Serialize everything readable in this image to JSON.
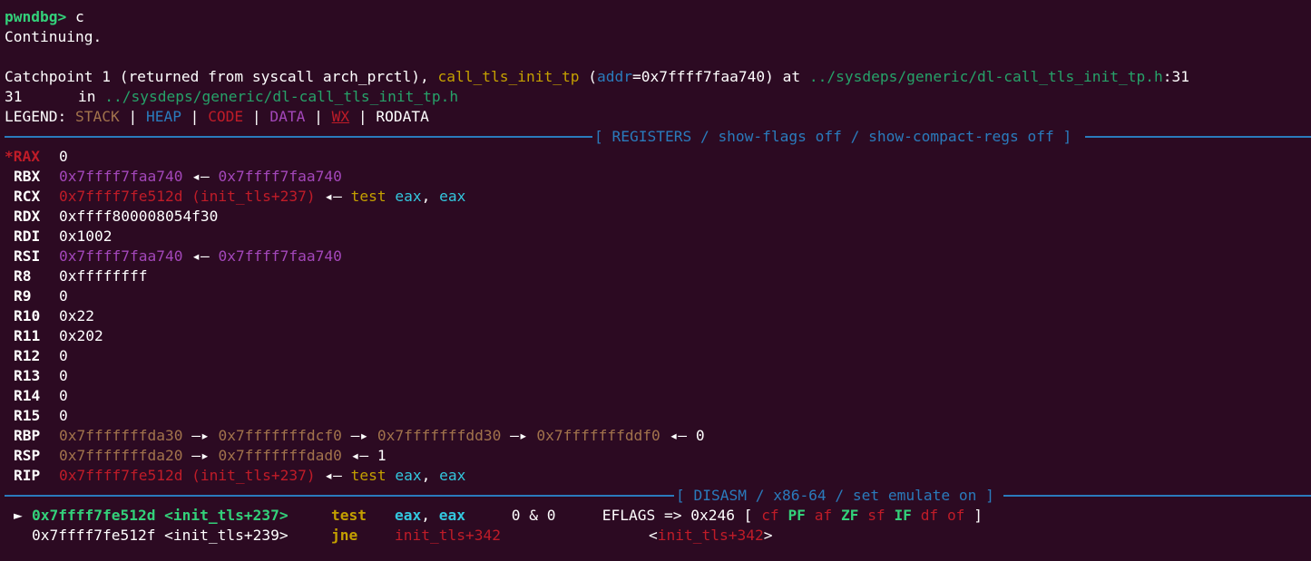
{
  "prompt": {
    "label": "pwndbg>",
    "command": " c"
  },
  "continuing": "Continuing.",
  "catchpoint": {
    "prefix": "Catchpoint 1 (returned from syscall arch_prctl), ",
    "func": "call_tls_init_tp",
    "paren_open": " (",
    "arg_name": "addr",
    "arg_value": "=0x7ffff7faa740)",
    "at": " at ",
    "file": "../sysdeps/generic/dl-call_tls_init_tp.h",
    "line": ":31"
  },
  "source_line": {
    "number": "31",
    "in": "in ",
    "file": "../sysdeps/generic/dl-call_tls_init_tp.h"
  },
  "legend": {
    "label": "LEGEND: ",
    "items": [
      "STACK",
      "HEAP",
      "CODE",
      "DATA",
      "WX",
      "RODATA"
    ],
    "sep": " | "
  },
  "registers_header": "[ REGISTERS / show-flags off / show-compact-regs off ]",
  "registers": [
    {
      "name": "*RAX",
      "value": "0"
    },
    {
      "name": "RBX",
      "value": "0x7ffff7faa740",
      "arrow": "◂—",
      "target": "0x7ffff7faa740"
    },
    {
      "name": "RCX",
      "value": "0x7ffff7fe512d (init_tls+237)",
      "arrow": "◂—",
      "ins_mnemonic": "test",
      "ins_op1": "eax",
      "ins_comma": ", ",
      "ins_op2": "eax"
    },
    {
      "name": "RDX",
      "value": "0xffff800008054f30"
    },
    {
      "name": "RDI",
      "value": "0x1002"
    },
    {
      "name": "RSI",
      "value": "0x7ffff7faa740",
      "arrow": "◂—",
      "target": "0x7ffff7faa740"
    },
    {
      "name": "R8",
      "value": "0xffffffff"
    },
    {
      "name": "R9",
      "value": "0"
    },
    {
      "name": "R10",
      "value": "0x22"
    },
    {
      "name": "R11",
      "value": "0x202"
    },
    {
      "name": "R12",
      "value": "0"
    },
    {
      "name": "R13",
      "value": "0"
    },
    {
      "name": "R14",
      "value": "0"
    },
    {
      "name": "R15",
      "value": "0"
    },
    {
      "name": "RBP",
      "chain": [
        "0x7fffffffda30",
        "0x7fffffffdcf0",
        "0x7fffffffdd30",
        "0x7fffffffddf0"
      ],
      "chain_arrow": "—▸",
      "end_arrow": "◂—",
      "end": "0"
    },
    {
      "name": "RSP",
      "chain": [
        "0x7fffffffda20",
        "0x7fffffffdad0"
      ],
      "chain_arrow": "—▸",
      "end_arrow": "◂—",
      "end": "1"
    },
    {
      "name": "RIP",
      "value": "0x7ffff7fe512d (init_tls+237)",
      "arrow": "◂—",
      "ins_mnemonic": "test",
      "ins_op1": "eax",
      "ins_comma": ", ",
      "ins_op2": "eax"
    }
  ],
  "disasm_header": "[ DISASM / x86-64 / set emulate on ]",
  "disasm": [
    {
      "marker": "►",
      "addr": "0x7ffff7fe512d <init_tls+237>",
      "mnemonic": "test",
      "op1": "eax",
      "comma": ", ",
      "op2": "eax",
      "comment": "0 & 0",
      "eflags_label": "EFLAGS => 0x246 [",
      "flags": [
        "cf",
        "PF",
        "af",
        "ZF",
        "sf",
        "IF",
        "df",
        "of"
      ],
      "flags_end": "]"
    },
    {
      "marker": "",
      "addr": "0x7ffff7fe512f <init_tls+239>",
      "mnemonic": "jne",
      "target": "init_tls+342",
      "target2_open": "<",
      "target2": "init_tls+342",
      "target2_close": ">"
    }
  ],
  "colors": {
    "background": "#2c0a22",
    "green": "#26a269",
    "stack": "#a2734c",
    "heap": "#2a7bbc",
    "code": "#c01c28",
    "data": "#a347ba",
    "yellow": "#c4a000",
    "cyan": "#33c7de"
  }
}
